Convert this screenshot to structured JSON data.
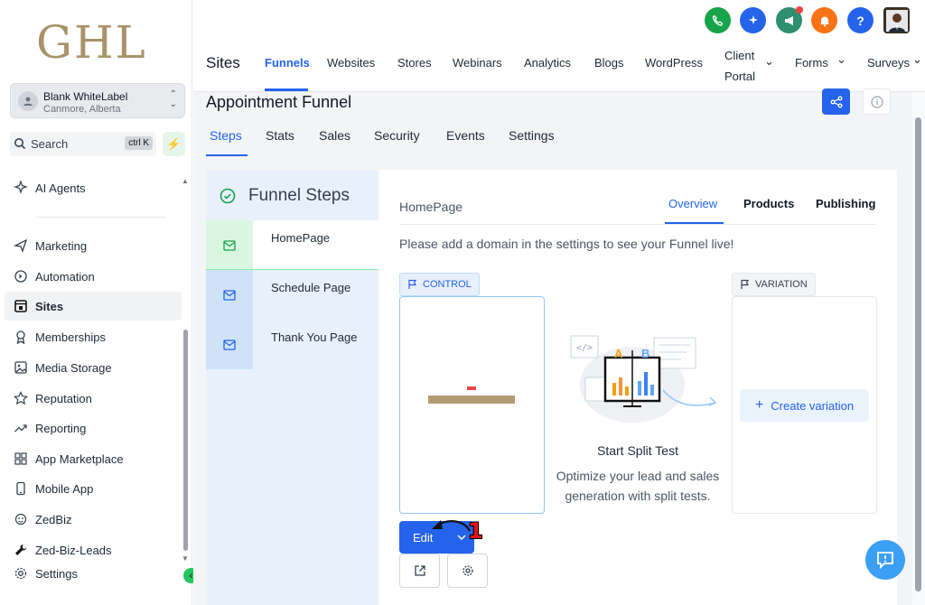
{
  "sidebar": {
    "logo": "GHL",
    "account": {
      "name": "Blank WhiteLabel",
      "location": "Canmore, Alberta"
    },
    "search": {
      "label": "Search",
      "shortcut": "ctrl K"
    },
    "items": [
      {
        "label": "AI Agents",
        "icon": "sparkle-icon"
      },
      {
        "label": "Marketing",
        "icon": "send-icon"
      },
      {
        "label": "Automation",
        "icon": "automation-icon"
      },
      {
        "label": "Sites",
        "icon": "sites-icon"
      },
      {
        "label": "Memberships",
        "icon": "memberships-icon"
      },
      {
        "label": "Media Storage",
        "icon": "image-icon"
      },
      {
        "label": "Reputation",
        "icon": "star-icon"
      },
      {
        "label": "Reporting",
        "icon": "chart-icon"
      },
      {
        "label": "App Marketplace",
        "icon": "grid-icon"
      },
      {
        "label": "Mobile App",
        "icon": "phone-icon"
      },
      {
        "label": "ZedBiz",
        "icon": "zedbiz-icon"
      },
      {
        "label": "Zed-Biz-Leads",
        "icon": "wrench-icon"
      },
      {
        "label": "Settings",
        "icon": "gear-icon"
      }
    ]
  },
  "topbar": {
    "section_title": "Sites",
    "nav": [
      "Funnels",
      "Websites",
      "Stores",
      "Webinars",
      "Analytics",
      "Blogs",
      "WordPress",
      "Client Portal",
      "Forms",
      "Surveys"
    ],
    "icon_colors": {
      "phone": "#16a34a",
      "sparkle": "#2563eb",
      "megaphone": "#2f8f6f",
      "bell": "#f97316",
      "help": "#2563eb"
    }
  },
  "funnel": {
    "title": "Appointment Funnel",
    "tabs": [
      "Steps",
      "Stats",
      "Sales",
      "Security",
      "Events",
      "Settings"
    ],
    "steps_heading": "Funnel Steps",
    "steps": [
      "HomePage",
      "Schedule Page",
      "Thank You Page"
    ]
  },
  "step_detail": {
    "page_name": "HomePage",
    "tabs": [
      "Overview",
      "Products",
      "Publishing"
    ],
    "domain_message": "Please add a domain in the settings to see your Funnel live!",
    "control_label": "CONTROL",
    "variation_label": "VARIATION",
    "create_variation": "Create variation",
    "split_title": "Start Split Test",
    "split_desc": "Optimize your lead and sales generation with split tests.",
    "edit_label": "Edit",
    "annotation": "1"
  }
}
